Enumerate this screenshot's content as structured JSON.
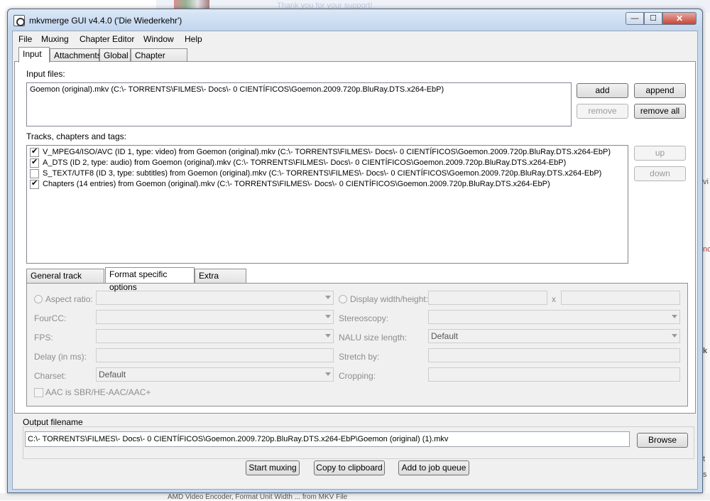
{
  "window": {
    "title": "mkvmerge GUI v4.4.0 ('Die Wiederkehr')",
    "controls": {
      "minimize": "—",
      "maximize": "☐",
      "close": "✕"
    }
  },
  "background": {
    "top_link": "Thank you for your support!",
    "right_chars": [
      "vi",
      "no",
      "k",
      "t",
      "s"
    ],
    "bottom_text": "AMD Video Encoder, Format Unit Width ... from MKV File"
  },
  "menu": [
    "File",
    "Muxing",
    "Chapter Editor",
    "Window",
    "Help"
  ],
  "main_tabs": [
    "Input",
    "Attachments",
    "Global",
    "Chapter Editor"
  ],
  "input": {
    "input_files_label": "Input files:",
    "files": [
      "Goemon (original).mkv (C:\\- TORRENTS\\FILMES\\- Docs\\- 0 CIENTÍFICOS\\Goemon.2009.720p.BluRay.DTS.x264-EbP)"
    ],
    "buttons": {
      "add": "add",
      "append": "append",
      "remove": "remove",
      "remove_all": "remove all"
    },
    "tracks_label": "Tracks, chapters and tags:",
    "tracks": [
      {
        "checked": true,
        "text": "V_MPEG4/ISO/AVC (ID 1, type: video) from Goemon (original).mkv (C:\\- TORRENTS\\FILMES\\- Docs\\- 0 CIENTÍFICOS\\Goemon.2009.720p.BluRay.DTS.x264-EbP)"
      },
      {
        "checked": true,
        "text": "A_DTS (ID 2, type: audio) from Goemon (original).mkv (C:\\- TORRENTS\\FILMES\\- Docs\\- 0 CIENTÍFICOS\\Goemon.2009.720p.BluRay.DTS.x264-EbP)"
      },
      {
        "checked": false,
        "text": "S_TEXT/UTF8 (ID 3, type: subtitles) from Goemon (original).mkv (C:\\- TORRENTS\\FILMES\\- Docs\\- 0 CIENTÍFICOS\\Goemon.2009.720p.BluRay.DTS.x264-EbP)"
      },
      {
        "checked": true,
        "text": "Chapters (14 entries) from Goemon (original).mkv (C:\\- TORRENTS\\FILMES\\- Docs\\- 0 CIENTÍFICOS\\Goemon.2009.720p.BluRay.DTS.x264-EbP)"
      }
    ],
    "track_buttons": {
      "up": "up",
      "down": "down"
    }
  },
  "option_tabs": [
    "General track options",
    "Format specific options",
    "Extra options"
  ],
  "format_options": {
    "aspect_ratio": "Aspect ratio:",
    "display_wh": "Display width/height:",
    "x_sep": "x",
    "fourcc": "FourCC:",
    "stereoscopy": "Stereoscopy:",
    "fps": "FPS:",
    "nalu": "NALU size length:",
    "nalu_value": "Default",
    "delay": "Delay (in ms):",
    "stretch": "Stretch by:",
    "charset": "Charset:",
    "charset_value": "Default",
    "cropping": "Cropping:",
    "aac_sbr": "AAC is SBR/HE-AAC/AAC+"
  },
  "output": {
    "label": "Output filename",
    "value": "C:\\- TORRENTS\\FILMES\\- Docs\\- 0 CIENTÍFICOS\\Goemon.2009.720p.BluRay.DTS.x264-EbP\\Goemon (original) (1).mkv",
    "browse": "Browse"
  },
  "actions": {
    "start_muxing": "Start muxing",
    "copy_clipboard": "Copy to clipboard",
    "add_job": "Add to job queue"
  }
}
